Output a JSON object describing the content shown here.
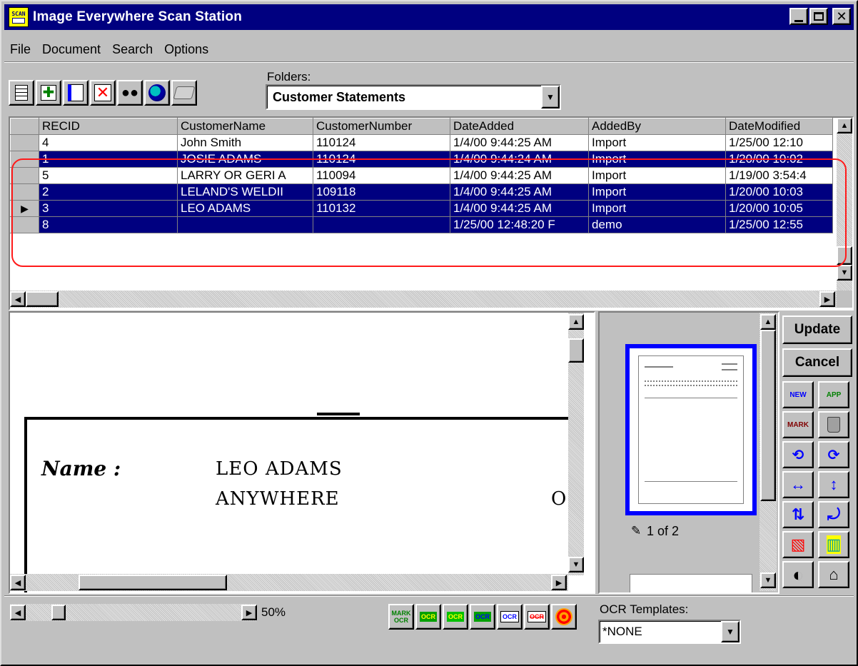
{
  "window": {
    "title": "Image Everywhere Scan Station",
    "icon_text": "SCAN",
    "controls": [
      "minimize",
      "maximize",
      "close"
    ]
  },
  "menu": [
    {
      "label": "File"
    },
    {
      "label": "Document"
    },
    {
      "label": "Search"
    },
    {
      "label": "Options"
    }
  ],
  "toolbar": {
    "folders_label": "Folders:",
    "folder_selected": "Customer Statements",
    "buttons": [
      "new-document-icon",
      "add-icon",
      "scan-icon",
      "delete-icon",
      "binoculars-icon",
      "web-search-icon",
      "print-icon"
    ]
  },
  "grid": {
    "columns": [
      "RECID",
      "CustomerName",
      "CustomerNumber",
      "DateAdded",
      "AddedBy",
      "DateModified"
    ],
    "rows": [
      {
        "cells": [
          "4",
          "John Smith",
          "110124",
          "1/4/00 9:44:25 AM",
          "Import",
          "1/25/00 12:10"
        ],
        "selected": false,
        "current": false
      },
      {
        "cells": [
          "1",
          "JOSIE ADAMS",
          "110124",
          "1/4/00 9:44:24 AM",
          "Import",
          "1/20/00 10:02"
        ],
        "selected": true,
        "current": false
      },
      {
        "cells": [
          "5",
          "LARRY OR GERI A",
          "110094",
          "1/4/00 9:44:25 AM",
          "Import",
          "1/19/00 3:54:4"
        ],
        "selected": false,
        "current": false
      },
      {
        "cells": [
          "2",
          "LELAND'S WELDII",
          "109118",
          "1/4/00 9:44:25 AM",
          "Import",
          "1/20/00 10:03"
        ],
        "selected": true,
        "current": false
      },
      {
        "cells": [
          "3",
          "LEO ADAMS",
          "110132",
          "1/4/00 9:44:25 AM",
          "Import",
          "1/20/00 10:05"
        ],
        "selected": true,
        "current": true
      },
      {
        "cells": [
          "8",
          "",
          "",
          "1/25/00 12:48:20 F",
          "demo",
          "1/25/00 12:55"
        ],
        "selected": true,
        "current": false
      }
    ]
  },
  "document": {
    "name_label": "Name :",
    "line1": "LEO ADAMS",
    "line2": "ANYWHERE",
    "line2_trailing": "O:"
  },
  "thumbnails": {
    "page_indicator": "1 of 2"
  },
  "side_buttons": {
    "update": "Update",
    "cancel": "Cancel",
    "icons": [
      {
        "name": "new-document-icon",
        "text": "NEW"
      },
      {
        "name": "append-icon",
        "text": "APP"
      },
      {
        "name": "mark-append-icon",
        "text": "MARK"
      },
      {
        "name": "recycle-icon",
        "text": ""
      },
      {
        "name": "rotate-left-icon",
        "text": "⟲"
      },
      {
        "name": "rotate-right-icon",
        "text": "⟳"
      },
      {
        "name": "fit-width-icon",
        "text": "↔"
      },
      {
        "name": "fit-height-icon",
        "text": "↕"
      },
      {
        "name": "flip-icon",
        "text": "⇅"
      },
      {
        "name": "deskew-icon",
        "text": "⤾"
      },
      {
        "name": "remove-noise-icon",
        "text": "▧"
      },
      {
        "name": "crop-icon",
        "text": "▥"
      },
      {
        "name": "invert-icon",
        "text": "◐"
      },
      {
        "name": "despeckle-icon",
        "text": "⌂"
      }
    ]
  },
  "status": {
    "zoom": "50%",
    "ocr_templates_label": "OCR Templates:",
    "ocr_template_selected": "*NONE",
    "ocr_buttons": [
      {
        "name": "mark-ocr-icon",
        "text": "MARK OCR"
      },
      {
        "name": "ocr-zone-icon",
        "text": "OCR"
      },
      {
        "name": "ocr-zone-green-icon",
        "text": "OCR"
      },
      {
        "name": "ocr-grid-icon",
        "text": "OCR"
      },
      {
        "name": "ocr-read-icon",
        "text": "OCR"
      },
      {
        "name": "ocr-delete-icon",
        "text": "OCR"
      },
      {
        "name": "target-icon",
        "text": ""
      }
    ]
  },
  "colors": {
    "titlebar": "#000080",
    "selection": "#000080",
    "face": "#c0c0c0",
    "highlight_outline": "#ff1a1a",
    "thumb_frame": "#0000ff"
  }
}
